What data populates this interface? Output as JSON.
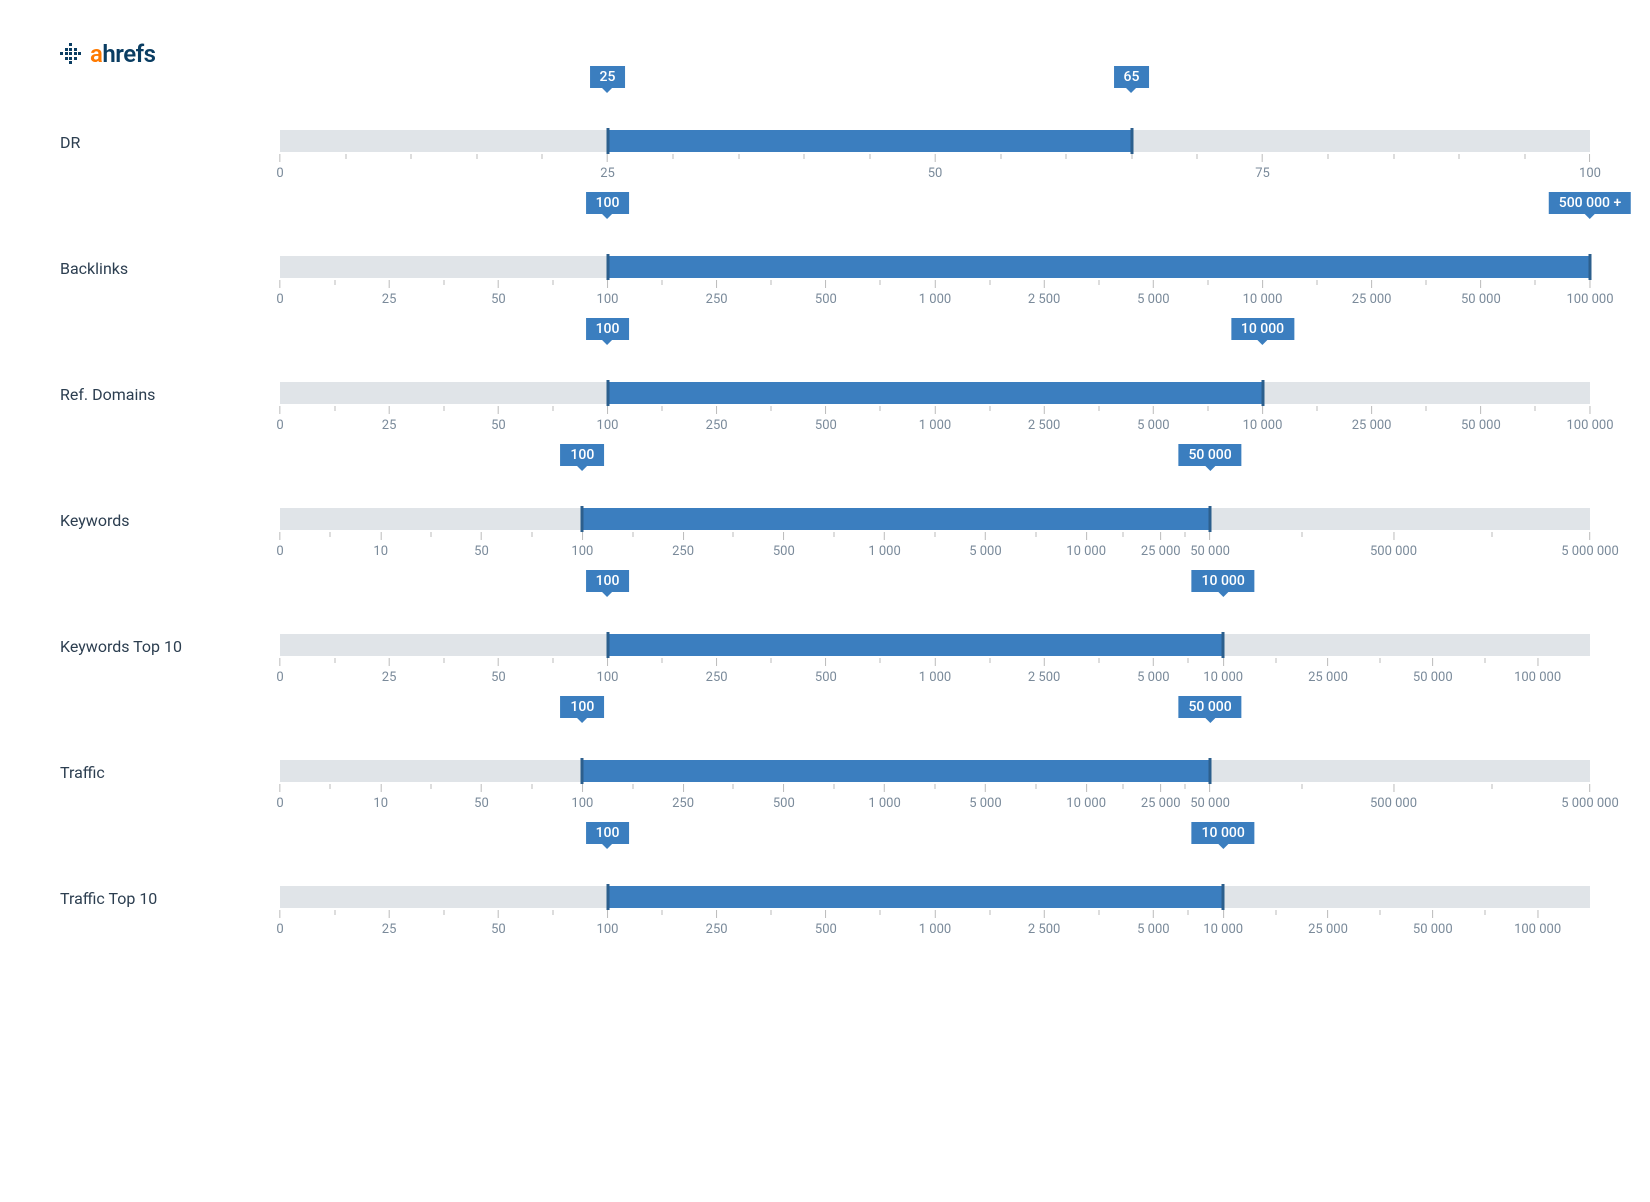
{
  "logo": {
    "a": "a",
    "hrefs": "hrefs"
  },
  "sliders": [
    {
      "label": "DR",
      "min_value": "25",
      "max_value": "65",
      "min_pct": 25,
      "max_pct": 65,
      "major_ticks": [
        {
          "label": "0",
          "pct": 0
        },
        {
          "label": "25",
          "pct": 25
        },
        {
          "label": "50",
          "pct": 50
        },
        {
          "label": "75",
          "pct": 75
        },
        {
          "label": "100",
          "pct": 100
        }
      ],
      "minor_ticks_per_gap": 4
    },
    {
      "label": "Backlinks",
      "min_value": "100",
      "max_value": "500 000 +",
      "min_pct": 25,
      "max_pct": 100,
      "major_ticks": [
        {
          "label": "0",
          "pct": 0
        },
        {
          "label": "25",
          "pct": 8.33
        },
        {
          "label": "50",
          "pct": 16.67
        },
        {
          "label": "100",
          "pct": 25
        },
        {
          "label": "250",
          "pct": 33.33
        },
        {
          "label": "500",
          "pct": 41.67
        },
        {
          "label": "1 000",
          "pct": 50
        },
        {
          "label": "2 500",
          "pct": 58.33
        },
        {
          "label": "5 000",
          "pct": 66.67
        },
        {
          "label": "10 000",
          "pct": 75
        },
        {
          "label": "25 000",
          "pct": 83.33
        },
        {
          "label": "50 000",
          "pct": 91.67
        },
        {
          "label": "100 000",
          "pct": 100
        }
      ],
      "minor_ticks_per_gap": 0
    },
    {
      "label": "Ref. Domains",
      "min_value": "100",
      "max_value": "10 000",
      "min_pct": 25,
      "max_pct": 75,
      "major_ticks": [
        {
          "label": "0",
          "pct": 0
        },
        {
          "label": "25",
          "pct": 8.33
        },
        {
          "label": "50",
          "pct": 16.67
        },
        {
          "label": "100",
          "pct": 25
        },
        {
          "label": "250",
          "pct": 33.33
        },
        {
          "label": "500",
          "pct": 41.67
        },
        {
          "label": "1 000",
          "pct": 50
        },
        {
          "label": "2 500",
          "pct": 58.33
        },
        {
          "label": "5 000",
          "pct": 66.67
        },
        {
          "label": "10 000",
          "pct": 75
        },
        {
          "label": "25 000",
          "pct": 83.33
        },
        {
          "label": "50 000",
          "pct": 91.67
        },
        {
          "label": "100 000",
          "pct": 100
        }
      ],
      "minor_ticks_per_gap": 0
    },
    {
      "label": "Keywords",
      "min_value": "100",
      "max_value": "50 000",
      "min_pct": 23.08,
      "max_pct": 71,
      "major_ticks": [
        {
          "label": "0",
          "pct": 0
        },
        {
          "label": "10",
          "pct": 7.69
        },
        {
          "label": "50",
          "pct": 15.38
        },
        {
          "label": "100",
          "pct": 23.08
        },
        {
          "label": "250",
          "pct": 30.77
        },
        {
          "label": "500",
          "pct": 38.46
        },
        {
          "label": "1 000",
          "pct": 46.15
        },
        {
          "label": "5 000",
          "pct": 53.85
        },
        {
          "label": "10 000",
          "pct": 61.54
        },
        {
          "label": "25 000",
          "pct": 67.23
        },
        {
          "label": "50 000",
          "pct": 71
        },
        {
          "label": "500 000",
          "pct": 85
        },
        {
          "label": "5 000 000",
          "pct": 100
        }
      ],
      "minor_ticks_per_gap": 0
    },
    {
      "label": "Keywords Top 10",
      "min_value": "100",
      "max_value": "10 000",
      "min_pct": 25,
      "max_pct": 72,
      "major_ticks": [
        {
          "label": "0",
          "pct": 0
        },
        {
          "label": "25",
          "pct": 8.33
        },
        {
          "label": "50",
          "pct": 16.67
        },
        {
          "label": "100",
          "pct": 25
        },
        {
          "label": "250",
          "pct": 33.33
        },
        {
          "label": "500",
          "pct": 41.67
        },
        {
          "label": "1 000",
          "pct": 50
        },
        {
          "label": "2 500",
          "pct": 58.33
        },
        {
          "label": "5 000",
          "pct": 66.67
        },
        {
          "label": "10 000",
          "pct": 72
        },
        {
          "label": "25 000",
          "pct": 80
        },
        {
          "label": "50 000",
          "pct": 88
        },
        {
          "label": "100 000",
          "pct": 96
        }
      ],
      "minor_ticks_per_gap": 0
    },
    {
      "label": "Traffic",
      "min_value": "100",
      "max_value": "50 000",
      "min_pct": 23.08,
      "max_pct": 71,
      "major_ticks": [
        {
          "label": "0",
          "pct": 0
        },
        {
          "label": "10",
          "pct": 7.69
        },
        {
          "label": "50",
          "pct": 15.38
        },
        {
          "label": "100",
          "pct": 23.08
        },
        {
          "label": "250",
          "pct": 30.77
        },
        {
          "label": "500",
          "pct": 38.46
        },
        {
          "label": "1 000",
          "pct": 46.15
        },
        {
          "label": "5 000",
          "pct": 53.85
        },
        {
          "label": "10 000",
          "pct": 61.54
        },
        {
          "label": "25 000",
          "pct": 67.23
        },
        {
          "label": "50 000",
          "pct": 71
        },
        {
          "label": "500 000",
          "pct": 85
        },
        {
          "label": "5 000 000",
          "pct": 100
        }
      ],
      "minor_ticks_per_gap": 0
    },
    {
      "label": "Traffic Top 10",
      "min_value": "100",
      "max_value": "10 000",
      "min_pct": 25,
      "max_pct": 72,
      "major_ticks": [
        {
          "label": "0",
          "pct": 0
        },
        {
          "label": "25",
          "pct": 8.33
        },
        {
          "label": "50",
          "pct": 16.67
        },
        {
          "label": "100",
          "pct": 25
        },
        {
          "label": "250",
          "pct": 33.33
        },
        {
          "label": "500",
          "pct": 41.67
        },
        {
          "label": "1 000",
          "pct": 50
        },
        {
          "label": "2 500",
          "pct": 58.33
        },
        {
          "label": "5 000",
          "pct": 66.67
        },
        {
          "label": "10 000",
          "pct": 72
        },
        {
          "label": "25 000",
          "pct": 80
        },
        {
          "label": "50 000",
          "pct": 88
        },
        {
          "label": "100 000",
          "pct": 96
        }
      ],
      "minor_ticks_per_gap": 0
    }
  ]
}
